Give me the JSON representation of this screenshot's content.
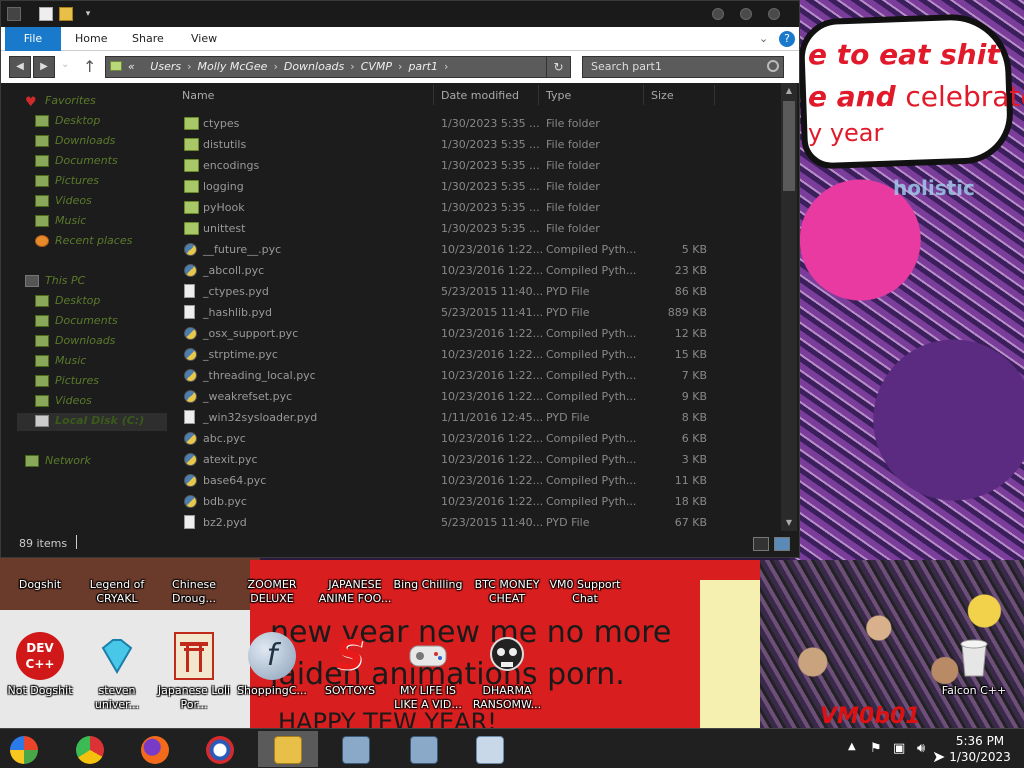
{
  "wallpaper": {
    "bubble_line1": "e to eat shit",
    "bubble_line2_bold": "e and",
    "bubble_line2_normal": "celebrate",
    "bubble_line3": "y year",
    "art_text": "holistic",
    "slogan": "new year new me no more jaiden animations porn.",
    "slogan2": "HAPPY TEW YEAR!",
    "signature": "VM0b01"
  },
  "explorer": {
    "ribbon_tabs": [
      "File",
      "Home",
      "Share",
      "View"
    ],
    "address": {
      "prefix": "«",
      "crumbs": [
        "Users",
        "Molly McGee",
        "Downloads",
        "CVMP",
        "part1"
      ]
    },
    "search_placeholder": "Search part1",
    "nav": {
      "favorites_header": "Favorites",
      "favorites": [
        "Desktop",
        "Downloads",
        "Documents",
        "Pictures",
        "Videos",
        "Music",
        "Recent places"
      ],
      "thispc_header": "This PC",
      "thispc": [
        "Desktop",
        "Documents",
        "Downloads",
        "Music",
        "Pictures",
        "Videos",
        "Local Disk (C:)"
      ],
      "network": "Network"
    },
    "columns": [
      "Name",
      "Date modified",
      "Type",
      "Size"
    ],
    "files": [
      {
        "name": "ctypes",
        "date": "1/30/2023 5:35 ...",
        "type": "File folder",
        "size": "",
        "kind": "folder"
      },
      {
        "name": "distutils",
        "date": "1/30/2023 5:35 ...",
        "type": "File folder",
        "size": "",
        "kind": "folder"
      },
      {
        "name": "encodings",
        "date": "1/30/2023 5:35 ...",
        "type": "File folder",
        "size": "",
        "kind": "folder"
      },
      {
        "name": "logging",
        "date": "1/30/2023 5:35 ...",
        "type": "File folder",
        "size": "",
        "kind": "folder"
      },
      {
        "name": "pyHook",
        "date": "1/30/2023 5:35 ...",
        "type": "File folder",
        "size": "",
        "kind": "folder"
      },
      {
        "name": "unittest",
        "date": "1/30/2023 5:35 ...",
        "type": "File folder",
        "size": "",
        "kind": "folder"
      },
      {
        "name": "__future__.pyc",
        "date": "10/23/2016 1:22...",
        "type": "Compiled Pyth...",
        "size": "5 KB",
        "kind": "pyc"
      },
      {
        "name": "_abcoll.pyc",
        "date": "10/23/2016 1:22...",
        "type": "Compiled Pyth...",
        "size": "23 KB",
        "kind": "pyc"
      },
      {
        "name": "_ctypes.pyd",
        "date": "5/23/2015 11:40...",
        "type": "PYD File",
        "size": "86 KB",
        "kind": "pyd"
      },
      {
        "name": "_hashlib.pyd",
        "date": "5/23/2015 11:41...",
        "type": "PYD File",
        "size": "889 KB",
        "kind": "pyd"
      },
      {
        "name": "_osx_support.pyc",
        "date": "10/23/2016 1:22...",
        "type": "Compiled Pyth...",
        "size": "12 KB",
        "kind": "pyc"
      },
      {
        "name": "_strptime.pyc",
        "date": "10/23/2016 1:22...",
        "type": "Compiled Pyth...",
        "size": "15 KB",
        "kind": "pyc"
      },
      {
        "name": "_threading_local.pyc",
        "date": "10/23/2016 1:22...",
        "type": "Compiled Pyth...",
        "size": "7 KB",
        "kind": "pyc"
      },
      {
        "name": "_weakrefset.pyc",
        "date": "10/23/2016 1:22...",
        "type": "Compiled Pyth...",
        "size": "9 KB",
        "kind": "pyc"
      },
      {
        "name": "_win32sysloader.pyd",
        "date": "1/11/2016 12:45...",
        "type": "PYD File",
        "size": "8 KB",
        "kind": "pyd"
      },
      {
        "name": "abc.pyc",
        "date": "10/23/2016 1:22...",
        "type": "Compiled Pyth...",
        "size": "6 KB",
        "kind": "pyc"
      },
      {
        "name": "atexit.pyc",
        "date": "10/23/2016 1:22...",
        "type": "Compiled Pyth...",
        "size": "3 KB",
        "kind": "pyc"
      },
      {
        "name": "base64.pyc",
        "date": "10/23/2016 1:22...",
        "type": "Compiled Pyth...",
        "size": "11 KB",
        "kind": "pyc"
      },
      {
        "name": "bdb.pyc",
        "date": "10/23/2016 1:22...",
        "type": "Compiled Pyth...",
        "size": "18 KB",
        "kind": "pyc"
      },
      {
        "name": "bz2.pyd",
        "date": "5/23/2015 11:40...",
        "type": "PYD File",
        "size": "67 KB",
        "kind": "pyd"
      }
    ],
    "status": "89 items"
  },
  "desktop_icons_row1": [
    "Dogshit",
    "Legend of CRYAKL",
    "Chinese Droug...",
    "ZOOMER DELUXE",
    "JAPANESE ANIME FOO...",
    "Bing Chilling",
    "BTC MONEY CHEAT",
    "VM0 Support Chat"
  ],
  "desktop_icons_row2": [
    "Not Dogshit",
    "steven univer...",
    "Japanese Loli Por...",
    "ShoppingC...",
    "SOYTOYS",
    "MY LIFE IS LIKE A VID...",
    "DHARMA RANSOMW...",
    "Falcon C++"
  ],
  "devcpp_label": "DEV C++",
  "clock": {
    "time": "5:36 PM",
    "date": "1/30/2023"
  },
  "colors": {
    "ribbon_file": "#1979ca",
    "window_bg": "#1c1c1c",
    "taskbar": "#202020"
  }
}
